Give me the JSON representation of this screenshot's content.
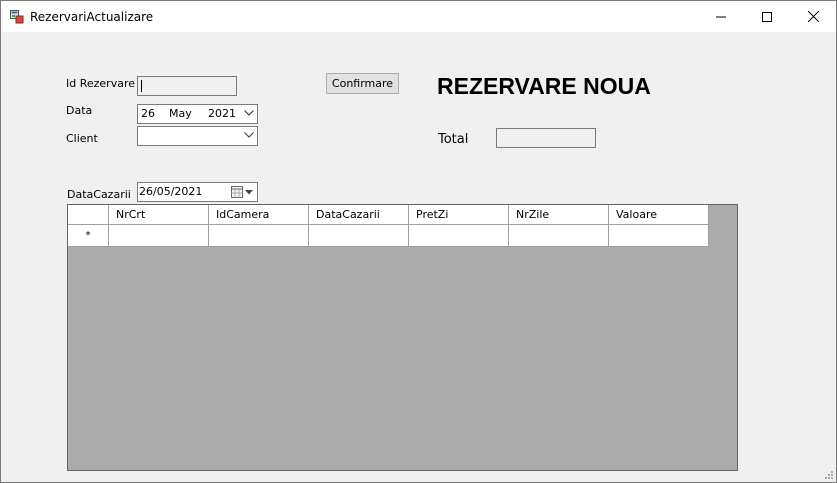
{
  "window": {
    "title": "RezervariActualizare",
    "icon": "form-app-icon",
    "controls": [
      "minimize-icon",
      "maximize-icon",
      "close-icon"
    ]
  },
  "form": {
    "id_rezervare_label": "Id Rezervare",
    "id_rezervare_value": "",
    "data_label": "Data",
    "data_day": "26",
    "data_month": "May",
    "data_year": "2021",
    "client_label": "Client",
    "client_value": "",
    "confirm_button": "Confirmare",
    "heading": "REZERVARE NOUA",
    "total_label": "Total",
    "total_value": "",
    "data_cazarii_label": "DataCazarii",
    "data_cazarii_value": "26/05/2021"
  },
  "grid": {
    "columns": [
      {
        "label": "NrCrt"
      },
      {
        "label": "IdCamera"
      },
      {
        "label": "DataCazarii"
      },
      {
        "label": "PretZi"
      },
      {
        "label": "NrZile"
      },
      {
        "label": "Valoare"
      }
    ],
    "new_row_marker": "*"
  }
}
